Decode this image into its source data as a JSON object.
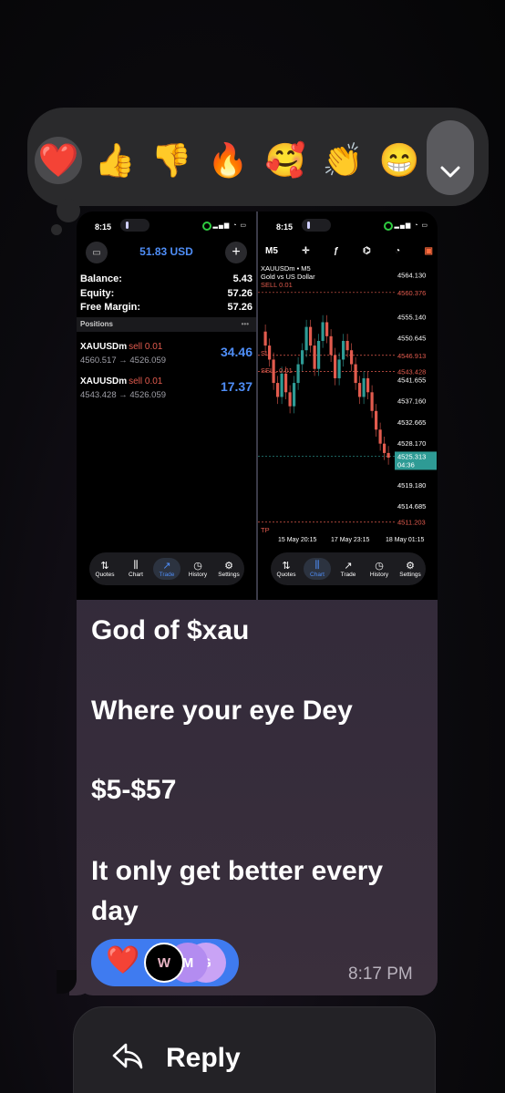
{
  "reactions": [
    {
      "emoji": "❤️",
      "name": "heart",
      "selected": true
    },
    {
      "emoji": "👍",
      "name": "thumbs-up"
    },
    {
      "emoji": "👎",
      "name": "thumbs-down"
    },
    {
      "emoji": "🔥",
      "name": "fire"
    },
    {
      "emoji": "🥰",
      "name": "smiling-hearts"
    },
    {
      "emoji": "👏",
      "name": "clap"
    },
    {
      "emoji": "😁",
      "name": "grin"
    }
  ],
  "screenshot": {
    "left": {
      "time": "8:15",
      "balance_header": "51.83 USD",
      "account": [
        {
          "label": "Balance:",
          "value": "5.43"
        },
        {
          "label": "Equity:",
          "value": "57.26"
        },
        {
          "label": "Free Margin:",
          "value": "57.26"
        }
      ],
      "positions_label": "Positions",
      "positions_dots": "•••",
      "positions": [
        {
          "symbol": "XAUUSDm",
          "side": "sell 0.01",
          "prices": "4560.517 → 4526.059",
          "profit": "34.46"
        },
        {
          "symbol": "XAUUSDm",
          "side": "sell 0.01",
          "prices": "4543.428 → 4526.059",
          "profit": "17.37"
        }
      ],
      "tabs": [
        "Quotes",
        "Chart",
        "Trade",
        "History",
        "Settings"
      ],
      "active_tab": "Trade"
    },
    "right": {
      "time": "8:15",
      "timeframe": "M5",
      "symbol_line": "XAUUSDm • M5",
      "symbol_desc": "Gold vs US Dollar",
      "sell_label_1": "SELL 0.01",
      "sl_label": "SL",
      "sell_label_2": "SELL 0.01",
      "tp_label": "TP",
      "price_ticks": [
        "4564.130",
        "4555.140",
        "4550.645",
        "4541.655",
        "4537.160",
        "4532.665",
        "4528.170",
        "4519.180",
        "4514.685"
      ],
      "marked_prices": [
        "4560.376",
        "4546.913",
        "4543.428"
      ],
      "tp_price": "4511.203",
      "current_price": "4525.313",
      "countdown": "04:36",
      "time_ticks": [
        "15 May 20:15",
        "17 May 23:15",
        "18 May 01:15"
      ],
      "tabs": [
        "Quotes",
        "Chart",
        "Trade",
        "History",
        "Settings"
      ],
      "active_tab": "Chart",
      "colors": {
        "up": "#2e9b95",
        "down": "#e25b4e",
        "current": "#2e9b95"
      }
    }
  },
  "message": {
    "lines": [
      "God of $xau",
      "Where your eye Dey",
      "$5-$57",
      "It only get better every day"
    ],
    "timestamp": "8:17 PM"
  },
  "reaction_pill": {
    "emoji": "❤️",
    "avatars": [
      "W",
      "M",
      "G"
    ]
  },
  "reply": {
    "label": "Reply"
  }
}
